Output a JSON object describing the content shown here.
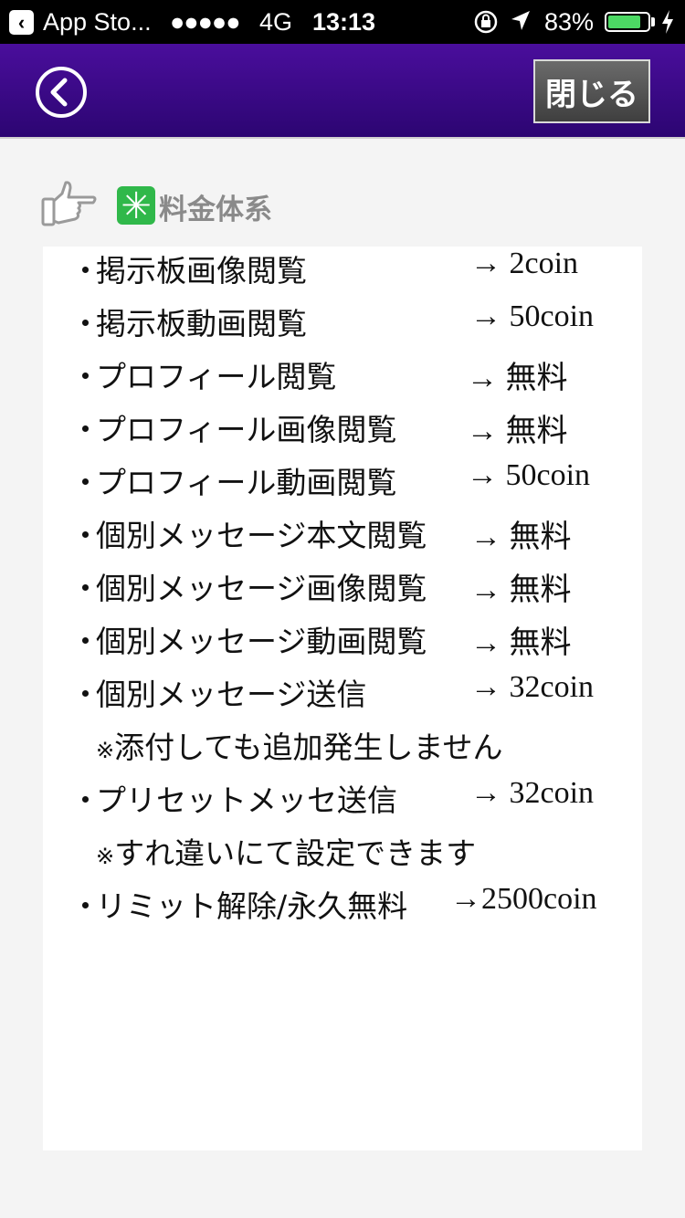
{
  "status_bar": {
    "back_app": "App Sto...",
    "signal": "●●●●●",
    "network": "4G",
    "time": "13:13",
    "battery_percent": "83%",
    "battery_level": 0.83
  },
  "nav": {
    "close_label": "閉じる"
  },
  "section": {
    "title": "料金体系",
    "badge": "✳"
  },
  "rates": [
    {
      "bullet": "・",
      "label": "掲示板画像閲覧",
      "price": "→ 2coin"
    },
    {
      "bullet": "・",
      "label": "掲示板動画閲覧",
      "price": "→ 50coin"
    },
    {
      "bullet": "・",
      "label": "プロフィール閲覧",
      "price": "→ 無料"
    },
    {
      "bullet": "・",
      "label": "プロフィール画像閲覧",
      "price": "→ 無料"
    },
    {
      "bullet": "・",
      "label": "プロフィール動画閲覧",
      "price": "→ 50coin"
    },
    {
      "bullet": "・",
      "label": "個別メッセージ本文閲覧",
      "price": "→ 無料"
    },
    {
      "bullet": "・",
      "label": "個別メッセージ画像閲覧",
      "price": "→ 無料"
    },
    {
      "bullet": "・",
      "label": "個別メッセージ動画閲覧",
      "price": "→ 無料"
    },
    {
      "bullet": "・",
      "label": "個別メッセージ送信",
      "price": "→ 32coin"
    },
    {
      "note_mark": "※",
      "note": "添付しても追加発生しません"
    },
    {
      "bullet": "・",
      "label": "プリセットメッセ送信",
      "price": "→ 32coin"
    },
    {
      "note_mark": "※",
      "note": "すれ違いにて設定できます"
    },
    {
      "bullet": "・",
      "label": "リミット解除/永久無料",
      "price": "→2500coin"
    }
  ]
}
